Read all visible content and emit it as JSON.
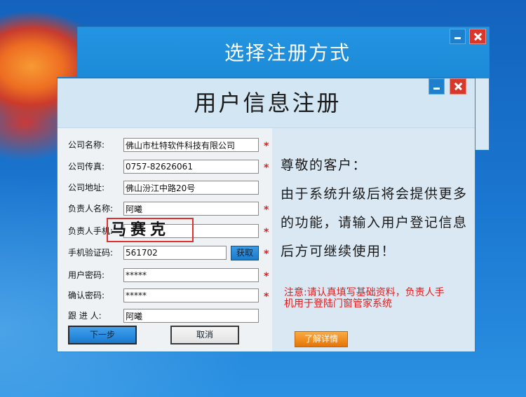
{
  "colors": {
    "title_bar": "#1b8ad7",
    "window_body": "#d8e8f5",
    "close_button": "#d9372b",
    "required_mark": "#e31b1b",
    "primary_button": "#2a8ce0",
    "details_button": "#f08a1c"
  },
  "back_window": {
    "title": "选择注册方式",
    "controls": {
      "minimize_icon": "minimize-icon",
      "close_icon": "close-icon"
    }
  },
  "front_window": {
    "title": "用户信息注册",
    "controls": {
      "minimize_icon": "minimize-icon",
      "close_icon": "close-icon"
    },
    "form": {
      "fields": [
        {
          "label": "公司名称:",
          "value": "佛山市杜特软件科技有限公司",
          "required": "*"
        },
        {
          "label": "公司传真:",
          "value": "0757-82626061",
          "required": "*"
        },
        {
          "label": "公司地址:",
          "value": "佛山汾江中路20号",
          "required": ""
        },
        {
          "label": "负责人名称:",
          "value": "阿曦",
          "required": "*"
        },
        {
          "label": "负责人手机:",
          "value": "",
          "required": "*"
        },
        {
          "label": "手机验证码:",
          "value": "561702",
          "required": "*"
        },
        {
          "label": "用户密码:",
          "value": "*****",
          "required": "*"
        },
        {
          "label": "确认密码:",
          "value": "*****",
          "required": "*"
        },
        {
          "label": "跟 进 人:",
          "value": "阿曦",
          "required": ""
        }
      ],
      "get_code_button": "获取",
      "mosaic_label": "马赛克",
      "next_button": "下一步",
      "cancel_button": "取消"
    },
    "info": {
      "greeting": "尊敬的客户：",
      "lines": [
        "由于系统升级后将会提供更多",
        "的功能，请输入用户登记信息",
        "后方可继续使用！"
      ],
      "note_lines": [
        "注意:请认真填写基础资料，负责人手",
        "机用于登陆门窗管家系统"
      ],
      "details_button": "了解详情"
    }
  }
}
